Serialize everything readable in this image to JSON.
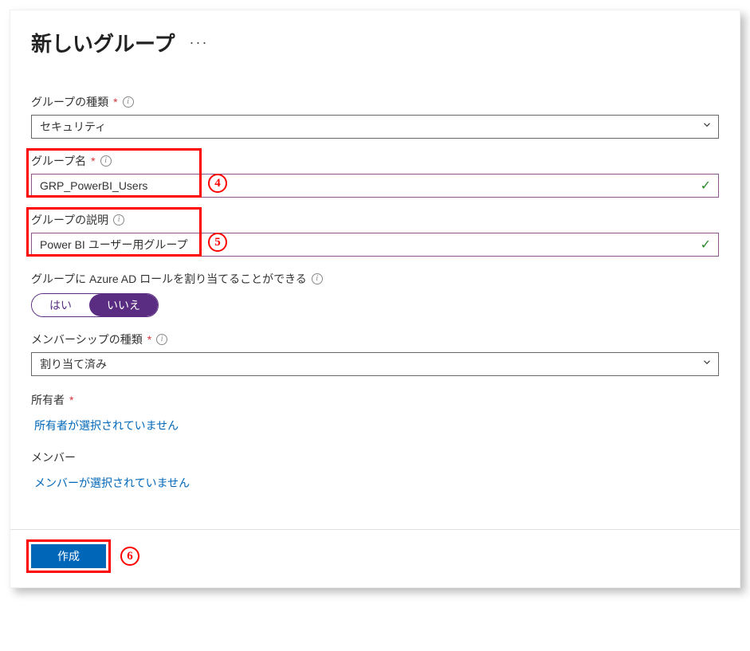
{
  "header": {
    "title": "新しいグループ"
  },
  "fields": {
    "group_type": {
      "label": "グループの種類",
      "value": "セキュリティ"
    },
    "group_name": {
      "label": "グループ名",
      "value": "GRP_PowerBI_Users"
    },
    "group_desc": {
      "label": "グループの説明",
      "value": "Power BI ユーザー用グループ"
    },
    "aad_roles": {
      "label": "グループに Azure AD ロールを割り当てることができる",
      "yes": "はい",
      "no": "いいえ"
    },
    "membership": {
      "label": "メンバーシップの種類",
      "value": "割り当て済み"
    },
    "owners": {
      "label": "所有者",
      "link_text": "所有者が選択されていません"
    },
    "members": {
      "label": "メンバー",
      "link_text": "メンバーが選択されていません"
    }
  },
  "buttons": {
    "create": "作成"
  },
  "annotations": {
    "a4": "4",
    "a5": "5",
    "a6": "6"
  }
}
